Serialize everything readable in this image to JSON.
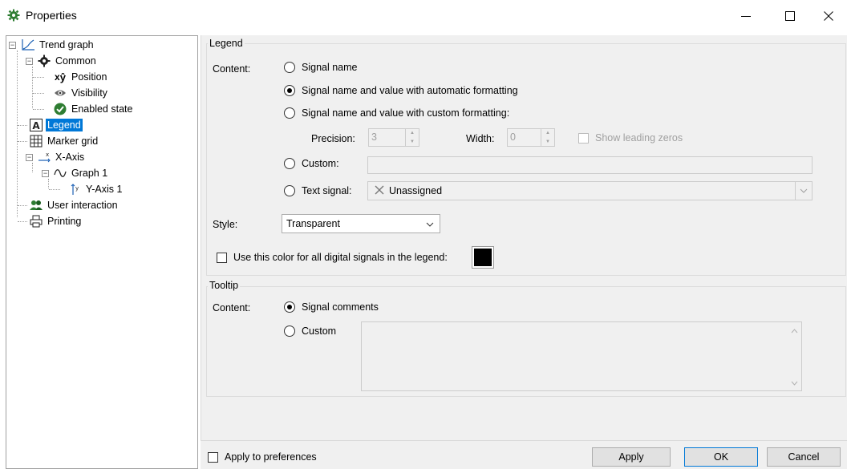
{
  "window": {
    "title": "Properties",
    "controls": {
      "minimize": "minimize-icon",
      "maximize": "maximize-icon",
      "close": "close-icon"
    }
  },
  "tree": {
    "items": [
      {
        "label": "Trend graph",
        "icon": "trend-graph-icon"
      },
      {
        "label": "Common",
        "icon": "gear-icon"
      },
      {
        "label": "Position",
        "icon": "xy-position-icon"
      },
      {
        "label": "Visibility",
        "icon": "eye-icon"
      },
      {
        "label": "Enabled state",
        "icon": "check-circle-icon"
      },
      {
        "label": "Legend",
        "icon": "legend-a-icon"
      },
      {
        "label": "Marker grid",
        "icon": "grid-icon"
      },
      {
        "label": "X-Axis",
        "icon": "x-axis-icon"
      },
      {
        "label": "Graph 1",
        "icon": "wave-icon"
      },
      {
        "label": "Y-Axis 1",
        "icon": "y-axis-icon"
      },
      {
        "label": "User interaction",
        "icon": "users-icon"
      },
      {
        "label": "Printing",
        "icon": "printer-icon"
      }
    ],
    "selected": "Legend"
  },
  "legend": {
    "group_title": "Legend",
    "content_label": "Content:",
    "options": {
      "signal_name": "Signal name",
      "auto_format": "Signal name and value with automatic formatting",
      "custom_format": "Signal name and value with custom formatting:",
      "custom": "Custom:",
      "text_signal": "Text signal:"
    },
    "selected_option": "auto_format",
    "precision_label": "Precision:",
    "precision_value": "3",
    "width_label": "Width:",
    "width_value": "0",
    "show_leading_zeros": "Show leading zeros",
    "custom_value": "",
    "text_signal_value": "Unassigned",
    "style_label": "Style:",
    "style_value": "Transparent",
    "digital_color_label": "Use this color for all digital signals in the legend:",
    "digital_color": "#000000"
  },
  "tooltip": {
    "group_title": "Tooltip",
    "content_label": "Content:",
    "options": {
      "signal_comments": "Signal comments",
      "custom": "Custom"
    },
    "selected_option": "signal_comments",
    "custom_value": ""
  },
  "footer": {
    "apply_to_preferences": "Apply to preferences",
    "apply": "Apply",
    "ok": "OK",
    "cancel": "Cancel"
  },
  "colors": {
    "selection": "#0078d7",
    "panel_bg": "#f0f0f0",
    "icon_green": "#2e7d32"
  }
}
